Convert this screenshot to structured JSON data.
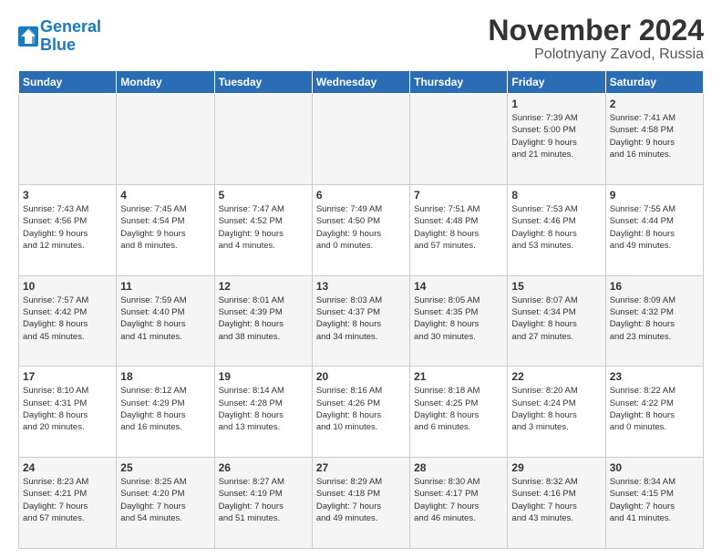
{
  "logo": {
    "text_general": "General",
    "text_blue": "Blue"
  },
  "title": "November 2024",
  "subtitle": "Polotnyany Zavod, Russia",
  "weekdays": [
    "Sunday",
    "Monday",
    "Tuesday",
    "Wednesday",
    "Thursday",
    "Friday",
    "Saturday"
  ],
  "weeks": [
    [
      {
        "day": "",
        "info": ""
      },
      {
        "day": "",
        "info": ""
      },
      {
        "day": "",
        "info": ""
      },
      {
        "day": "",
        "info": ""
      },
      {
        "day": "",
        "info": ""
      },
      {
        "day": "1",
        "info": "Sunrise: 7:39 AM\nSunset: 5:00 PM\nDaylight: 9 hours\nand 21 minutes."
      },
      {
        "day": "2",
        "info": "Sunrise: 7:41 AM\nSunset: 4:58 PM\nDaylight: 9 hours\nand 16 minutes."
      }
    ],
    [
      {
        "day": "3",
        "info": "Sunrise: 7:43 AM\nSunset: 4:56 PM\nDaylight: 9 hours\nand 12 minutes."
      },
      {
        "day": "4",
        "info": "Sunrise: 7:45 AM\nSunset: 4:54 PM\nDaylight: 9 hours\nand 8 minutes."
      },
      {
        "day": "5",
        "info": "Sunrise: 7:47 AM\nSunset: 4:52 PM\nDaylight: 9 hours\nand 4 minutes."
      },
      {
        "day": "6",
        "info": "Sunrise: 7:49 AM\nSunset: 4:50 PM\nDaylight: 9 hours\nand 0 minutes."
      },
      {
        "day": "7",
        "info": "Sunrise: 7:51 AM\nSunset: 4:48 PM\nDaylight: 8 hours\nand 57 minutes."
      },
      {
        "day": "8",
        "info": "Sunrise: 7:53 AM\nSunset: 4:46 PM\nDaylight: 8 hours\nand 53 minutes."
      },
      {
        "day": "9",
        "info": "Sunrise: 7:55 AM\nSunset: 4:44 PM\nDaylight: 8 hours\nand 49 minutes."
      }
    ],
    [
      {
        "day": "10",
        "info": "Sunrise: 7:57 AM\nSunset: 4:42 PM\nDaylight: 8 hours\nand 45 minutes."
      },
      {
        "day": "11",
        "info": "Sunrise: 7:59 AM\nSunset: 4:40 PM\nDaylight: 8 hours\nand 41 minutes."
      },
      {
        "day": "12",
        "info": "Sunrise: 8:01 AM\nSunset: 4:39 PM\nDaylight: 8 hours\nand 38 minutes."
      },
      {
        "day": "13",
        "info": "Sunrise: 8:03 AM\nSunset: 4:37 PM\nDaylight: 8 hours\nand 34 minutes."
      },
      {
        "day": "14",
        "info": "Sunrise: 8:05 AM\nSunset: 4:35 PM\nDaylight: 8 hours\nand 30 minutes."
      },
      {
        "day": "15",
        "info": "Sunrise: 8:07 AM\nSunset: 4:34 PM\nDaylight: 8 hours\nand 27 minutes."
      },
      {
        "day": "16",
        "info": "Sunrise: 8:09 AM\nSunset: 4:32 PM\nDaylight: 8 hours\nand 23 minutes."
      }
    ],
    [
      {
        "day": "17",
        "info": "Sunrise: 8:10 AM\nSunset: 4:31 PM\nDaylight: 8 hours\nand 20 minutes."
      },
      {
        "day": "18",
        "info": "Sunrise: 8:12 AM\nSunset: 4:29 PM\nDaylight: 8 hours\nand 16 minutes."
      },
      {
        "day": "19",
        "info": "Sunrise: 8:14 AM\nSunset: 4:28 PM\nDaylight: 8 hours\nand 13 minutes."
      },
      {
        "day": "20",
        "info": "Sunrise: 8:16 AM\nSunset: 4:26 PM\nDaylight: 8 hours\nand 10 minutes."
      },
      {
        "day": "21",
        "info": "Sunrise: 8:18 AM\nSunset: 4:25 PM\nDaylight: 8 hours\nand 6 minutes."
      },
      {
        "day": "22",
        "info": "Sunrise: 8:20 AM\nSunset: 4:24 PM\nDaylight: 8 hours\nand 3 minutes."
      },
      {
        "day": "23",
        "info": "Sunrise: 8:22 AM\nSunset: 4:22 PM\nDaylight: 8 hours\nand 0 minutes."
      }
    ],
    [
      {
        "day": "24",
        "info": "Sunrise: 8:23 AM\nSunset: 4:21 PM\nDaylight: 7 hours\nand 57 minutes."
      },
      {
        "day": "25",
        "info": "Sunrise: 8:25 AM\nSunset: 4:20 PM\nDaylight: 7 hours\nand 54 minutes."
      },
      {
        "day": "26",
        "info": "Sunrise: 8:27 AM\nSunset: 4:19 PM\nDaylight: 7 hours\nand 51 minutes."
      },
      {
        "day": "27",
        "info": "Sunrise: 8:29 AM\nSunset: 4:18 PM\nDaylight: 7 hours\nand 49 minutes."
      },
      {
        "day": "28",
        "info": "Sunrise: 8:30 AM\nSunset: 4:17 PM\nDaylight: 7 hours\nand 46 minutes."
      },
      {
        "day": "29",
        "info": "Sunrise: 8:32 AM\nSunset: 4:16 PM\nDaylight: 7 hours\nand 43 minutes."
      },
      {
        "day": "30",
        "info": "Sunrise: 8:34 AM\nSunset: 4:15 PM\nDaylight: 7 hours\nand 41 minutes."
      }
    ]
  ]
}
